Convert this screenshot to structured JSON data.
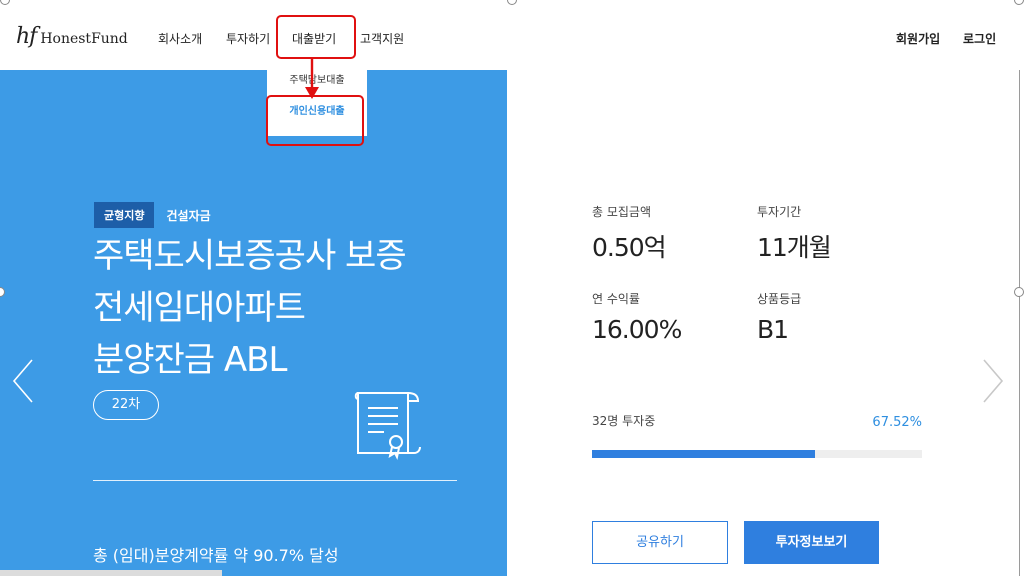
{
  "header": {
    "logo_mark": "hf",
    "logo_text": "HonestFund",
    "nav": [
      "회사소개",
      "투자하기",
      "대출받기",
      "고객지원"
    ],
    "signup": "회원가입",
    "login": "로그인"
  },
  "dropdown": {
    "items": [
      "주택담보대출",
      "개인신용대출"
    ]
  },
  "hero": {
    "badge_primary": "균형지향",
    "badge_secondary": "건설자금",
    "title_lines": [
      "주택도시보증공사 보증",
      "전세임대아파트",
      "분양잔금 ABL"
    ],
    "round": "22차",
    "footer": "총 (임대)분양계약률 약 90.7% 달성"
  },
  "stats": {
    "total_label": "총 모집금액",
    "total_value": "0.50억",
    "period_label": "투자기간",
    "period_value": "11개월",
    "rate_label": "연 수익률",
    "rate_value": "16.00%",
    "grade_label": "상품등급",
    "grade_value": "B1",
    "investors": "32명 투자중",
    "percent": "67.52%",
    "progress_fraction": 0.6752
  },
  "buttons": {
    "share": "공유하기",
    "info": "투자정보보기"
  },
  "colors": {
    "hero_bg": "#3d9be6",
    "badge_bg": "#1d5ea8",
    "accent": "#2f7fdf",
    "annotation": "#e01010"
  }
}
